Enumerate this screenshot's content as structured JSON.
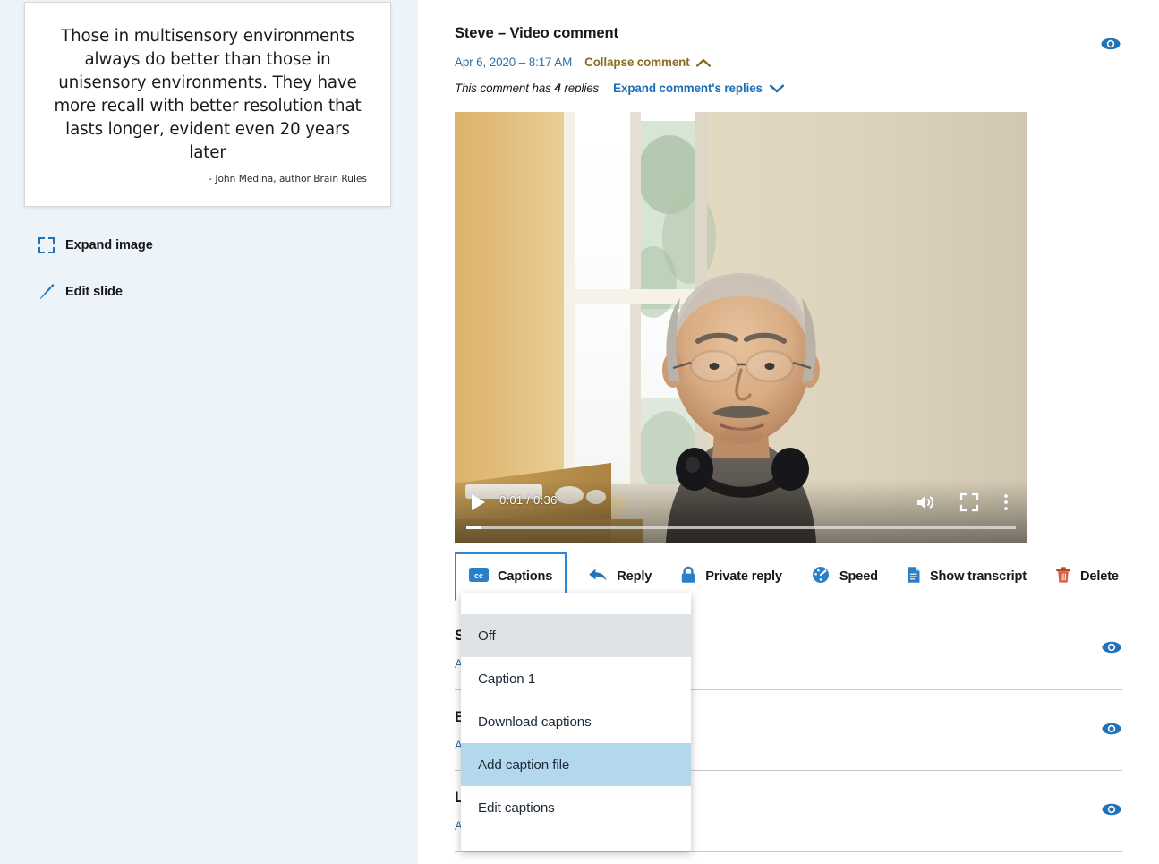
{
  "slide": {
    "quote": "Those in multisensory environments always do better than those in unisensory environments. They have more recall with better resolution that lasts longer, evident even 20 years later",
    "attribution": "- John Medina, author Brain Rules",
    "expand_image_label": "Expand image",
    "edit_slide_label": "Edit slide",
    "expand_icon": "expand-image-icon",
    "edit_icon": "pencil-icon"
  },
  "comment": {
    "title": "Steve – Video comment",
    "date": "Apr 6, 2020 – 8:17 AM",
    "collapse_label": "Collapse comment",
    "collapse_icon": "chevron-up-icon",
    "replies_text_before": "This comment has ",
    "replies_count": "4",
    "replies_text_after": " replies",
    "expand_replies_label": "Expand comment's replies",
    "expand_replies_icon": "chevron-down-icon",
    "visibility_icon": "eye-icon"
  },
  "video": {
    "current_time": "0:01",
    "duration": "0:36",
    "time_display": "0:01 / 0:36",
    "progress_percent": 2.8,
    "play_icon": "play-icon",
    "volume_icon": "volume-on-icon",
    "fullscreen_icon": "fullscreen-icon",
    "more_icon": "kebab-menu-icon"
  },
  "toolbar": {
    "items": [
      {
        "label": "Captions",
        "icon": "cc-icon",
        "active": true
      },
      {
        "label": "Reply",
        "icon": "reply-arrow-icon",
        "active": false
      },
      {
        "label": "Private reply",
        "icon": "lock-icon",
        "active": false
      },
      {
        "label": "Speed",
        "icon": "speedometer-icon",
        "active": false
      },
      {
        "label": "Show transcript",
        "icon": "document-icon",
        "active": false
      },
      {
        "label": "Delete",
        "icon": "trash-icon",
        "active": false
      }
    ]
  },
  "captions_menu": {
    "items": [
      {
        "label": "Off",
        "state": "selected"
      },
      {
        "label": "Caption 1",
        "state": "normal"
      },
      {
        "label": "Download captions",
        "state": "normal"
      },
      {
        "label": "Add caption file",
        "state": "hover"
      },
      {
        "label": "Edit captions",
        "state": "normal"
      }
    ]
  },
  "comment_list": {
    "rows": [
      {
        "title": "S",
        "date": "A",
        "expand_label": ""
      },
      {
        "title": "B",
        "date": "A",
        "expand_label": ""
      },
      {
        "title": "L",
        "date": "A",
        "expand_label": ""
      }
    ]
  },
  "colors": {
    "panel_bg": "#ecf3f9",
    "link_blue": "#1f6db5",
    "date_blue": "#2f6fa8",
    "gold": "#8a6d20",
    "accent": "#2f86d8",
    "delete_red": "#c0442a",
    "menu_selected": "#e0e3e6",
    "menu_hover": "#b3d8ed"
  }
}
